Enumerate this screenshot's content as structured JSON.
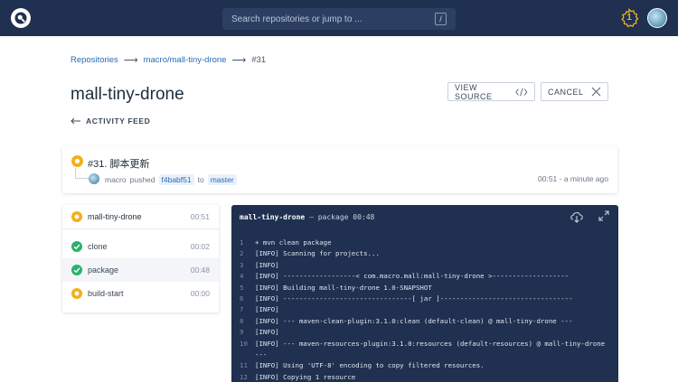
{
  "header": {
    "search_placeholder": "Search repositories or jump to ...",
    "search_shortcut": "/",
    "notification_count": "1",
    "colors": {
      "bar": "#1f3050",
      "accent": "#f2b01e"
    }
  },
  "breadcrumb": {
    "items": [
      "Repositories",
      "macro/mall-tiny-drone",
      "#31"
    ]
  },
  "page": {
    "title": "mall-tiny-drone",
    "view_source_label": "VIEW SOURCE",
    "cancel_label": "CANCEL",
    "activity_label": "ACTIVITY FEED"
  },
  "build": {
    "title": "#31. 脚本更新",
    "author": "macro",
    "action": "pushed",
    "commit": "f4babf51",
    "to_word": "to",
    "branch": "master",
    "time": "00:51 - a minute ago"
  },
  "stages": {
    "header": {
      "name": "mall-tiny-drone",
      "time": "00:51"
    },
    "items": [
      {
        "name": "clone",
        "time": "00:02",
        "status": "success"
      },
      {
        "name": "package",
        "time": "00:48",
        "status": "success"
      },
      {
        "name": "build-start",
        "time": "00:00",
        "status": "running"
      }
    ]
  },
  "log": {
    "title": "mall-tiny-drone",
    "separator": "—",
    "step": "package",
    "duration": "00:48",
    "lines": [
      {
        "n": "1",
        "text": "+ mvn clean package"
      },
      {
        "n": "2",
        "text": "[INFO] Scanning for projects..."
      },
      {
        "n": "3",
        "text": "[INFO]"
      },
      {
        "n": "4",
        "text": "[INFO] ------------------< com.macro.mall:mall-tiny-drone >-------------------"
      },
      {
        "n": "5",
        "text": "[INFO] Building mall-tiny-drone 1.0-SNAPSHOT"
      },
      {
        "n": "6",
        "text": "[INFO] --------------------------------[ jar ]---------------------------------"
      },
      {
        "n": "7",
        "text": "[INFO]"
      },
      {
        "n": "8",
        "text": "[INFO] --- maven-clean-plugin:3.1.0:clean (default-clean) @ mall-tiny-drone ---"
      },
      {
        "n": "9",
        "text": "[INFO]"
      },
      {
        "n": "10",
        "text": "[INFO] --- maven-resources-plugin:3.1.0:resources (default-resources) @ mall-tiny-drone ---"
      },
      {
        "n": "11",
        "text": "[INFO] Using 'UTF-8' encoding to copy filtered resources."
      },
      {
        "n": "12",
        "text": "[INFO] Copying 1 resource"
      }
    ]
  }
}
